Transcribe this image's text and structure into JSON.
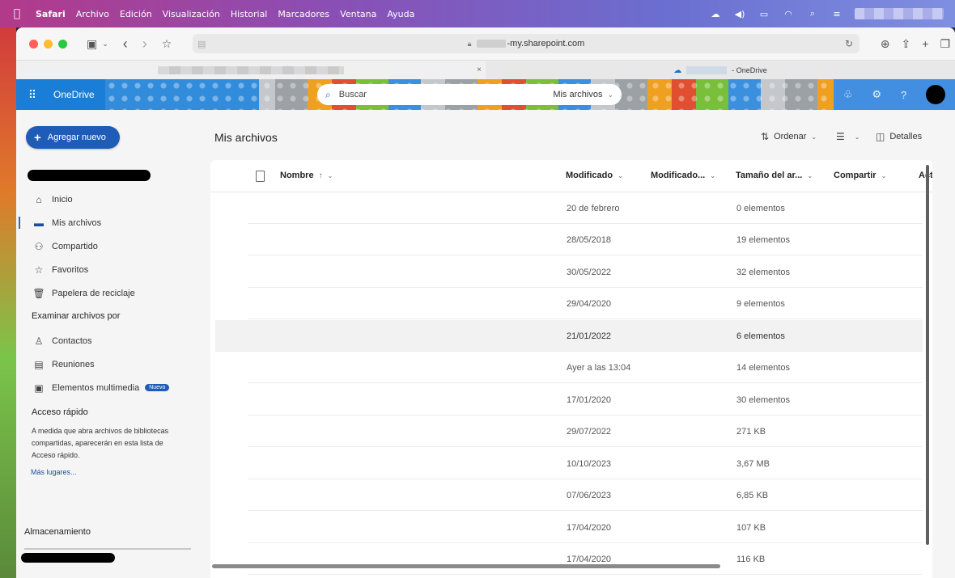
{
  "menubar": {
    "apple_icon": "apple-icon",
    "items": [
      "Safari",
      "Archivo",
      "Edición",
      "Visualización",
      "Historial",
      "Marcadores",
      "Ventana",
      "Ayuda"
    ]
  },
  "browser": {
    "url": "-my.sharepoint.com",
    "tabs": [
      {
        "title": "",
        "active": true
      },
      {
        "title": "- OneDrive",
        "active": false
      }
    ],
    "tab_close": "×"
  },
  "header": {
    "brand": "OneDrive",
    "search_placeholder": "Buscar",
    "search_scope": "Mis archivos"
  },
  "sidebar": {
    "new_button": "Agregar nuevo",
    "nav": [
      {
        "label": "Inicio",
        "icon": "home-icon",
        "active": false
      },
      {
        "label": "Mis archivos",
        "icon": "folder-icon",
        "active": true
      },
      {
        "label": "Compartido",
        "icon": "people-icon",
        "active": false
      },
      {
        "label": "Favoritos",
        "icon": "star-icon",
        "active": false
      },
      {
        "label": "Papelera de reciclaje",
        "icon": "trash-icon",
        "active": false
      }
    ],
    "browse_title": "Examinar archivos por",
    "browse": [
      {
        "label": "Contactos",
        "icon": "person-icon"
      },
      {
        "label": "Reuniones",
        "icon": "calendar-icon"
      },
      {
        "label": "Elementos multimedia",
        "icon": "image-icon",
        "badge": "Nuevo"
      }
    ],
    "quick_title": "Acceso rápido",
    "quick_text": "A medida que abra archivos de bibliotecas compartidas, aparecerán en esta lista de Acceso rápido.",
    "quick_link": "Más lugares...",
    "storage_title": "Almacenamiento"
  },
  "main": {
    "title": "Mis archivos",
    "sort_label": "Ordenar",
    "details_label": "Detalles",
    "columns": {
      "name": "Nombre",
      "modified": "Modificado",
      "modified_by": "Modificado...",
      "size": "Tamaño del ar...",
      "sharing": "Compartir",
      "activity": "Act"
    },
    "rows": [
      {
        "modified": "20 de febrero",
        "size": "0 elementos"
      },
      {
        "modified": "28/05/2018",
        "size": "19 elementos"
      },
      {
        "modified": "30/05/2022",
        "size": "32 elementos"
      },
      {
        "modified": "29/04/2020",
        "size": "9 elementos"
      },
      {
        "modified": "21/01/2022",
        "size": "6 elementos"
      },
      {
        "modified": "Ayer a las 13:04",
        "size": "14 elementos"
      },
      {
        "modified": "17/01/2020",
        "size": "30 elementos"
      },
      {
        "modified": "29/07/2022",
        "size": "271 KB"
      },
      {
        "modified": "10/10/2023",
        "size": "3,67 MB"
      },
      {
        "modified": "07/06/2023",
        "size": "6,85 KB"
      },
      {
        "modified": "17/04/2020",
        "size": "107 KB"
      },
      {
        "modified": "17/04/2020",
        "size": "116 KB"
      }
    ]
  }
}
